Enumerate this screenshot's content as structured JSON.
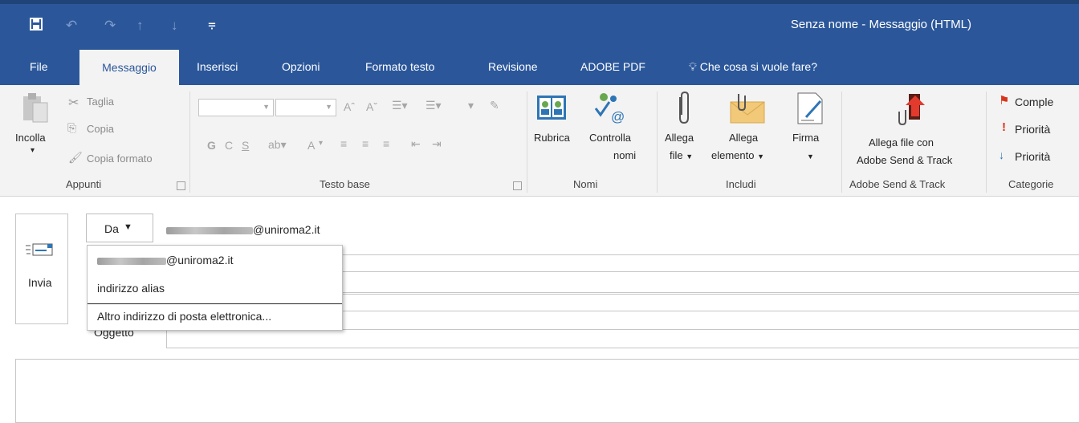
{
  "window": {
    "title": "Senza nome  -  Messaggio (HTML)"
  },
  "quick_access": {
    "save_icon": "save-icon",
    "undo_icon": "undo-icon",
    "redo_icon": "redo-icon",
    "up_icon": "arrow-up-icon",
    "down_icon": "arrow-down-icon",
    "customize_icon": "customize-quick-access-icon"
  },
  "tabs": [
    {
      "label": "File"
    },
    {
      "label": "Messaggio"
    },
    {
      "label": "Inserisci"
    },
    {
      "label": "Opzioni"
    },
    {
      "label": "Formato testo"
    },
    {
      "label": "Revisione"
    },
    {
      "label": "ADOBE PDF"
    }
  ],
  "tell_me": {
    "icon": "lightbulb-icon",
    "label": "Che cosa si vuole fare?"
  },
  "ribbon": {
    "clipboard": {
      "group_label": "Appunti",
      "paste": "Incolla",
      "cut": "Taglia",
      "copy": "Copia",
      "format_painter": "Copia formato"
    },
    "basic_text": {
      "group_label": "Testo base",
      "bold": "G",
      "italic": "C",
      "underline": "S",
      "font_color": "A"
    },
    "names": {
      "group_label": "Nomi",
      "address_book": "Rubrica",
      "check_names_1": "Controlla",
      "check_names_2": "nomi"
    },
    "include": {
      "group_label": "Includi",
      "attach_file_1": "Allega",
      "attach_file_2": "file",
      "attach_item_1": "Allega",
      "attach_item_2": "elemento",
      "signature": "Firma"
    },
    "adobe": {
      "group_label": "Adobe Send & Track",
      "button_1": "Allega file con",
      "button_2": "Adobe Send & Track"
    },
    "tags": {
      "group_label": "Categorie",
      "followup": "Comple",
      "high_priority": "Priorità",
      "low_priority": "Priorità"
    }
  },
  "compose": {
    "send_label": "Invia",
    "from_button": "Da",
    "from_value": "@uniroma2.it",
    "subject_label": "Oggetto"
  },
  "from_menu": {
    "items": [
      {
        "label": "@uniroma2.it"
      },
      {
        "label": "indirizzo alias"
      },
      {
        "label": "Altro indirizzo di posta elettronica..."
      }
    ]
  }
}
